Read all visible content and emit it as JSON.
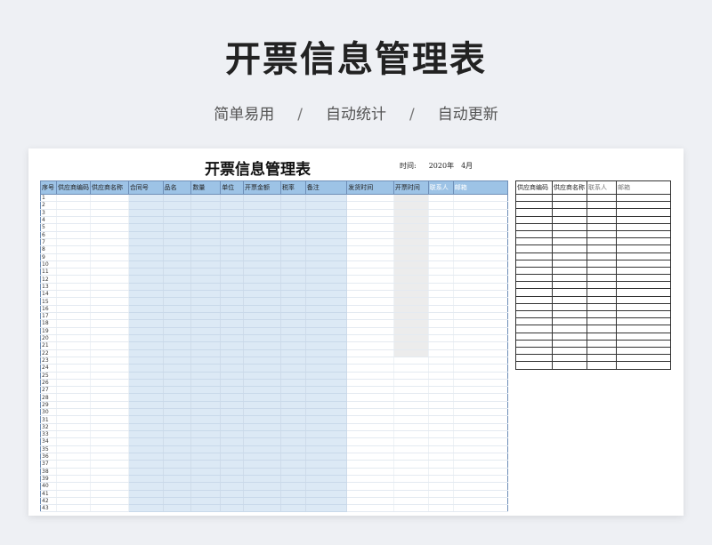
{
  "hero": {
    "title": "开票信息管理表",
    "taglines": [
      "简单易用",
      "/",
      "自动统计",
      "/",
      "自动更新"
    ]
  },
  "sheet": {
    "title": "开票信息管理表",
    "time_label": "时间:",
    "year": "2020年",
    "month": "4月",
    "main_table": {
      "columns": [
        {
          "label": "序号",
          "shade": "none"
        },
        {
          "label": "供应商编码",
          "shade": "none"
        },
        {
          "label": "供应商名称",
          "shade": "none"
        },
        {
          "label": "合同号",
          "shade": "blue"
        },
        {
          "label": "品名",
          "shade": "blue"
        },
        {
          "label": "数量",
          "shade": "blue"
        },
        {
          "label": "单位",
          "shade": "blue"
        },
        {
          "label": "开票金额",
          "shade": "blue"
        },
        {
          "label": "税率",
          "shade": "blue"
        },
        {
          "label": "备注",
          "shade": "blue"
        },
        {
          "label": "发货时间",
          "shade": "none"
        },
        {
          "label": "开票时间",
          "shade": "gray"
        },
        {
          "label": "联系人",
          "shade": "none",
          "light": true
        },
        {
          "label": "邮箱",
          "shade": "none",
          "light": true
        }
      ],
      "gray_rows_through": 22,
      "row_numbers": [
        "1",
        "2",
        "3",
        "4",
        "5",
        "6",
        "7",
        "8",
        "9",
        "10",
        "11",
        "12",
        "13",
        "14",
        "15",
        "16",
        "17",
        "18",
        "19",
        "20",
        "21",
        "22",
        "23",
        "24",
        "25",
        "26",
        "27",
        "28",
        "29",
        "30",
        "31",
        "32",
        "33",
        "34",
        "35",
        "36",
        "37",
        "38",
        "39",
        "40",
        "41",
        "42",
        "43"
      ]
    },
    "side_table": {
      "columns": [
        {
          "label": "供应商编码"
        },
        {
          "label": "供应商名称"
        },
        {
          "label": "联系人",
          "light": true
        },
        {
          "label": "邮箱",
          "light": true
        }
      ],
      "row_count": 24
    }
  }
}
